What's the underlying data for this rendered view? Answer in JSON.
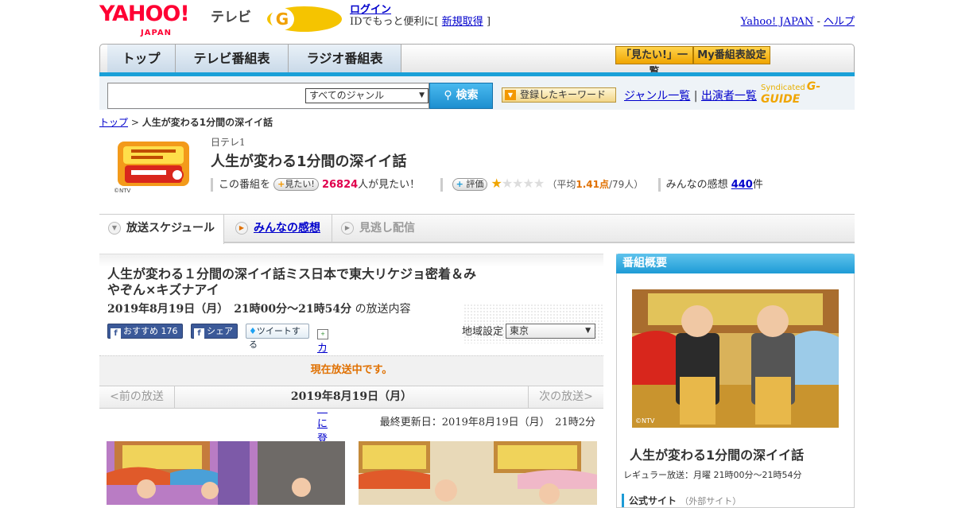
{
  "header": {
    "logo_yahoo": "YAHOO!",
    "logo_japan": "JAPAN",
    "logo_tv": "テレビ",
    "gguide_text": "G-GUIDE",
    "login_label": "ログイン",
    "login_desc": "IDでもっと便利に[",
    "signup_label": "新規取得",
    "login_close": "]",
    "yahoo_japan_link": "Yahoo! JAPAN",
    "separator": "-",
    "help_link": "ヘルプ"
  },
  "nav": {
    "tabs": [
      {
        "label": "トップ"
      },
      {
        "label": "テレビ番組表"
      },
      {
        "label": "ラジオ番組表"
      }
    ],
    "watch_list_button": "「見たい!」一覧",
    "my_schedule_button": "My番組表設定"
  },
  "search": {
    "input_value": "",
    "genre_select": "すべてのジャンル",
    "search_button": "検索",
    "keyword_button": "登録したキーワード",
    "genre_list_link": "ジャンル一覧",
    "divider": "|",
    "cast_list_link": "出演者一覧",
    "syndicated_label": "Syndicated",
    "syndicated_brand": "G-GUIDE"
  },
  "breadcrumb": {
    "top_link": "トップ",
    "separator": ">",
    "current": "人生が変わる1分間の深イイ話"
  },
  "program": {
    "logo_copyright": "©NTV",
    "channel": "日テレ1",
    "title": "人生が変わる1分間の深イイ話",
    "watch_prefix": "この番組を",
    "watch_button": "見たい!",
    "watch_count": "26824",
    "watch_suffix": "人が見たい！",
    "rating_button": "評価",
    "rating_value": 1.41,
    "rating_text_open": "（平均",
    "rating_avg": "1.41点",
    "rating_count": "/79人）",
    "impressions_label": "みんなの感想",
    "impressions_count": "440",
    "impressions_unit": "件"
  },
  "subtabs": [
    {
      "label": "放送スケジュール"
    },
    {
      "label": "みんなの感想"
    },
    {
      "label": "見逃し配信"
    }
  ],
  "episode": {
    "title": "人生が変わる１分間の深イイ話ミス日本で東大リケジョ密着＆みやぞん×キズナアイ",
    "date": "2019年8月19日（月）　21時00分～21時54分",
    "date_suffix": "の放送内容",
    "fb_recommend": "おすすめ",
    "fb_count": "176",
    "fb_share": "シェア",
    "tweet": "ツイートする",
    "calendar": "カレンダーに登録",
    "region_label": "地域設定",
    "region_value": "東京",
    "now_airing": "現在放送中です。",
    "prev": "<前の放送",
    "current_date": "2019年8月19日（月）",
    "next": "次の放送>",
    "updated": "最終更新日：2019年8月19日（月）　21時2分"
  },
  "sidebar": {
    "header": "番組概要",
    "image_copyright": "©NTV",
    "title": "人生が変わる1分間の深イイ話",
    "regular": "レギュラー放送：月曜 21時00分～21時54分",
    "official_site": "公式サイト",
    "official_site_note": "（外部サイト）"
  },
  "colors": {
    "accent_blue": "#1aa0d8",
    "yahoo_red": "#ff0033",
    "orange": "#e07000",
    "pink": "#e0004d"
  }
}
